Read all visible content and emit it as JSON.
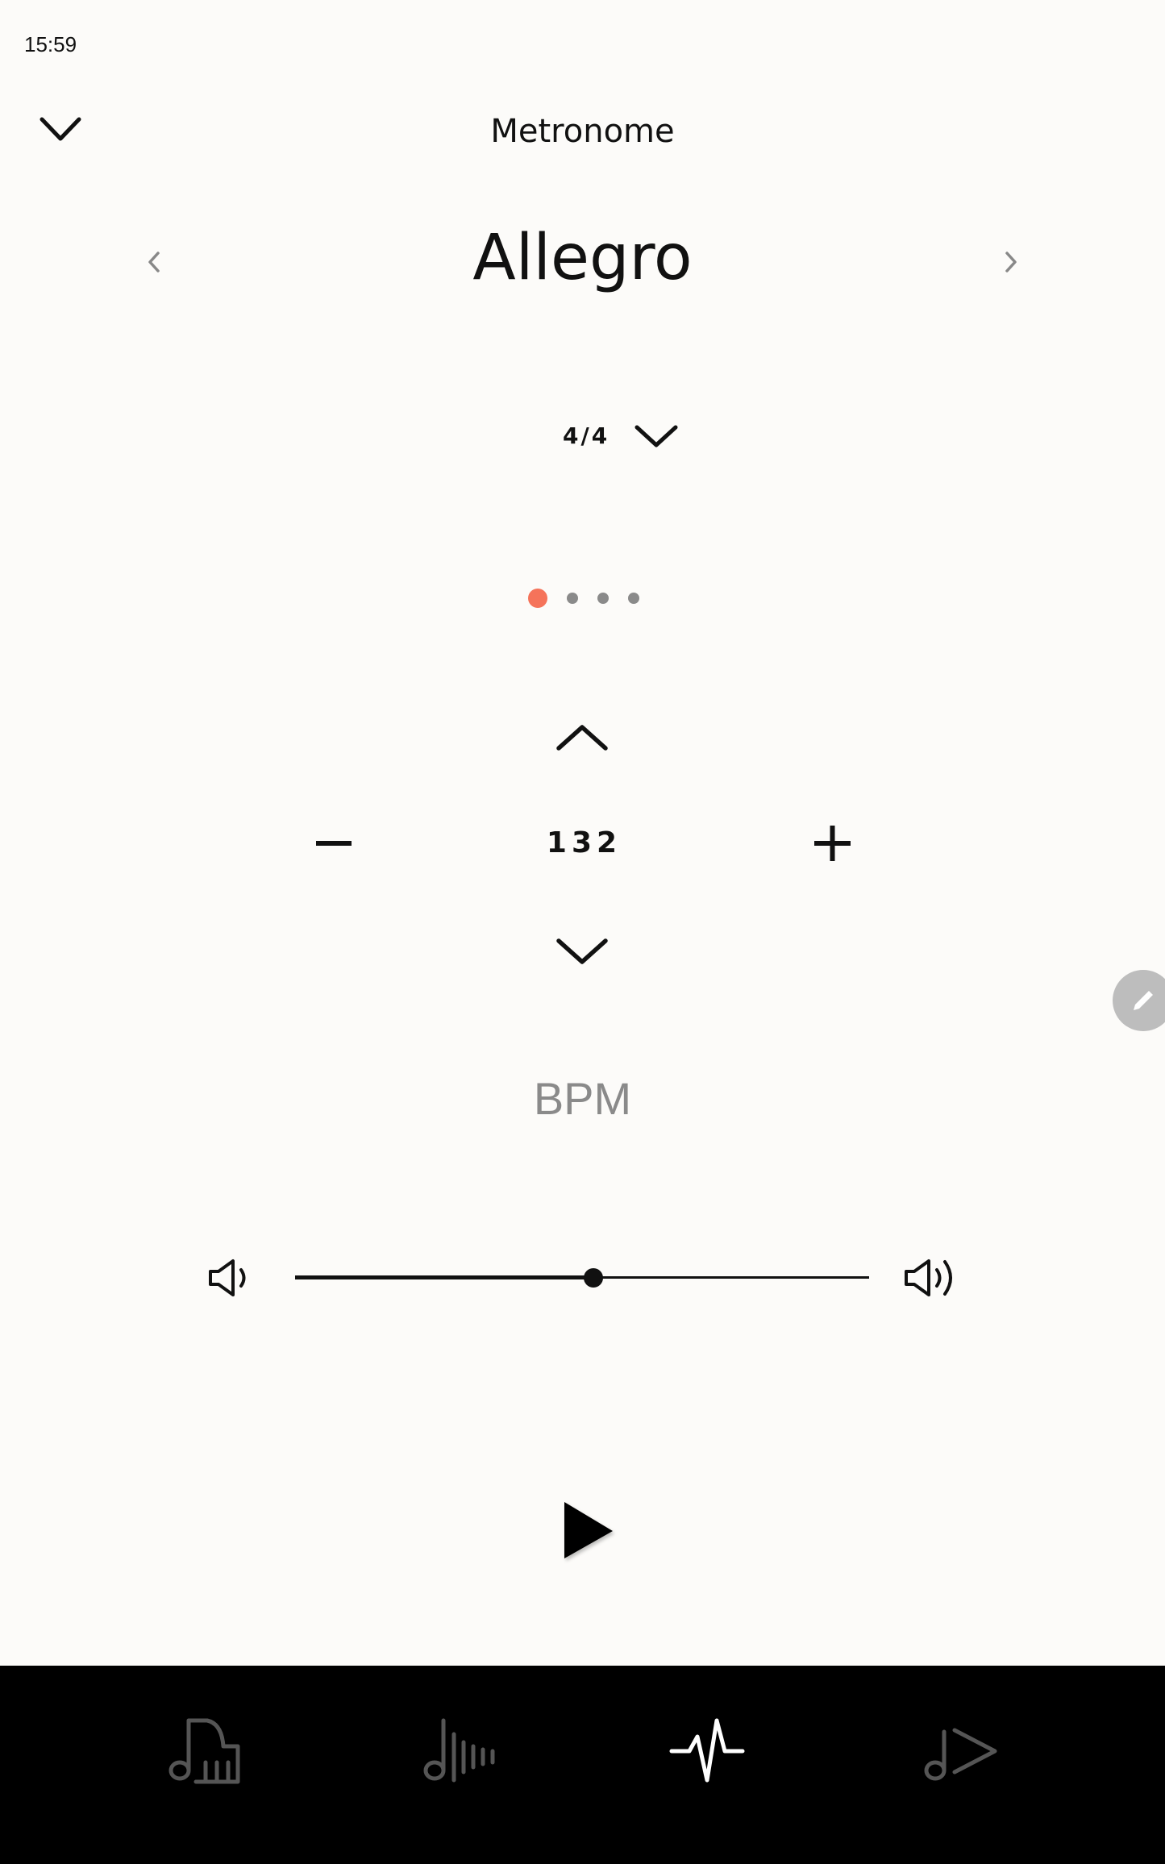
{
  "status_bar": {
    "time": "15:59"
  },
  "header": {
    "collapse_icon": "chevron-down-icon",
    "title": "Metronome"
  },
  "preset": {
    "name": "Allegro",
    "prev_icon": "chevron-left-icon",
    "next_icon": "chevron-right-icon"
  },
  "time_signature": {
    "value": "4/4",
    "dropdown_icon": "chevron-down-icon"
  },
  "beats": {
    "count": 4,
    "active_index": 0,
    "active_color": "#f5735a",
    "inactive_color": "#8a8a8a"
  },
  "tempo": {
    "value": "132",
    "unit": "BPM",
    "increase_icon": "chevron-up-icon",
    "decrease_icon": "chevron-down-icon",
    "minus_icon": "minus-icon",
    "plus_icon": "plus-icon"
  },
  "edit_fab": {
    "icon": "pencil-icon"
  },
  "volume": {
    "level": 0.52,
    "low_icon": "speaker-low-icon",
    "high_icon": "speaker-high-icon"
  },
  "playback": {
    "icon": "play-icon"
  },
  "bottom_nav": {
    "items": [
      {
        "icon": "piano-note-icon",
        "active": false
      },
      {
        "icon": "note-wave-icon",
        "active": false
      },
      {
        "icon": "pulse-icon",
        "active": true
      },
      {
        "icon": "note-play-icon",
        "active": false
      }
    ],
    "active_color": "#ffffff",
    "inactive_color": "#555555"
  }
}
